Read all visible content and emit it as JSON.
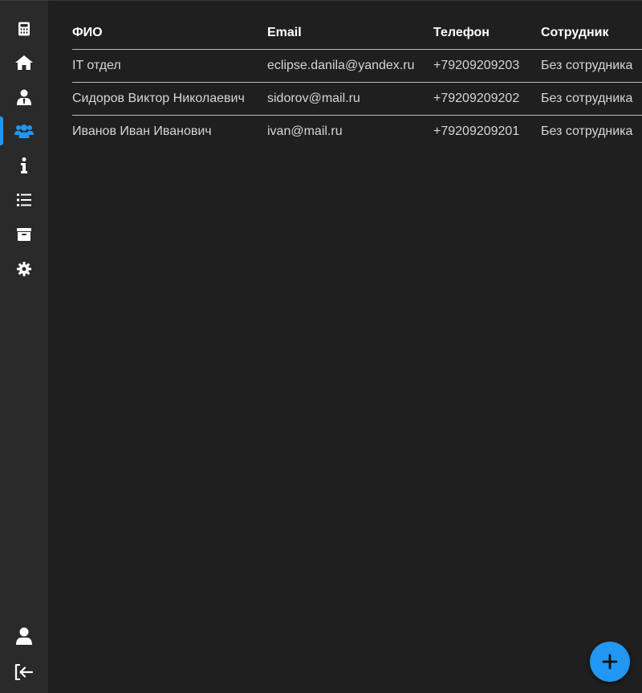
{
  "sidebar": {
    "items": [
      {
        "name": "calculator",
        "icon": "calculator-icon",
        "active": false
      },
      {
        "name": "home",
        "icon": "home-icon",
        "active": false
      },
      {
        "name": "user",
        "icon": "user-tie-icon",
        "active": false
      },
      {
        "name": "users",
        "icon": "users-icon",
        "active": true
      },
      {
        "name": "info",
        "icon": "info-icon",
        "active": false
      },
      {
        "name": "list",
        "icon": "list-icon",
        "active": false
      },
      {
        "name": "archive",
        "icon": "archive-icon",
        "active": false
      },
      {
        "name": "settings",
        "icon": "gear-icon",
        "active": false
      }
    ],
    "bottom": [
      {
        "name": "profile",
        "icon": "user-icon"
      },
      {
        "name": "logout",
        "icon": "logout-icon"
      }
    ],
    "accent": "#2196f3"
  },
  "table": {
    "headers": {
      "name": "ФИО",
      "email": "Email",
      "phone": "Телефон",
      "employee": "Сотрудник"
    },
    "rows": [
      {
        "name": "IT отдел",
        "email": "eclipse.danila@yandex.ru",
        "phone": "+79209209203",
        "employee": "Без сотрудника"
      },
      {
        "name": "Сидоров Виктор Николаевич",
        "email": "sidorov@mail.ru",
        "phone": "+79209209202",
        "employee": "Без сотрудника"
      },
      {
        "name": "Иванов Иван Иванович",
        "email": "ivan@mail.ru",
        "phone": "+79209209201",
        "employee": "Без сотрудника"
      }
    ]
  },
  "fab": {
    "icon": "plus-icon",
    "color": "#2196f3"
  }
}
